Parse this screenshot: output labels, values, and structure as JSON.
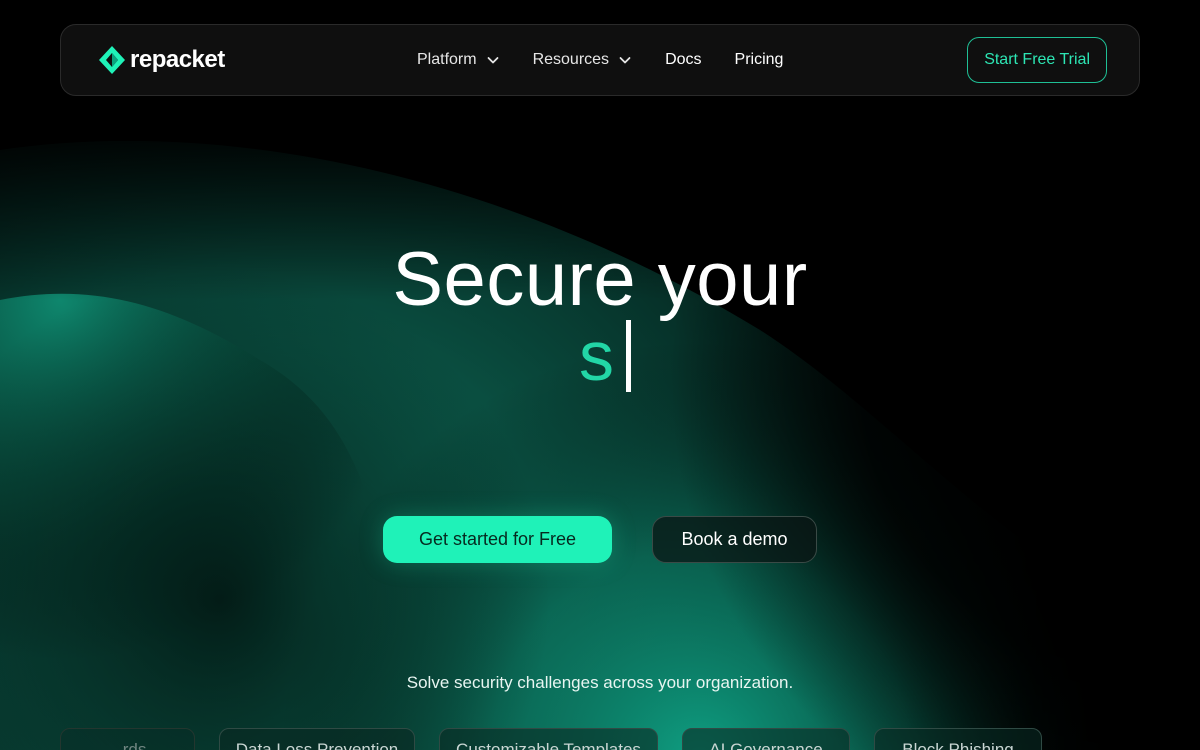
{
  "brand": {
    "name": "repacket",
    "accent": "#1ff2b8"
  },
  "nav": {
    "items": [
      {
        "label": "Platform",
        "has_dropdown": true
      },
      {
        "label": "Resources",
        "has_dropdown": true
      },
      {
        "label": "Docs",
        "has_dropdown": false
      },
      {
        "label": "Pricing",
        "has_dropdown": false
      }
    ],
    "cta_label": "Start Free Trial"
  },
  "hero": {
    "title": "Secure your",
    "typed_text": "s",
    "primary_cta": "Get started for Free",
    "secondary_cta": "Book a demo",
    "tagline": "Solve security challenges across your organization."
  },
  "solutions": [
    {
      "label": "...rds"
    },
    {
      "label": "Data Loss Prevention"
    },
    {
      "label": "Customizable Templates"
    },
    {
      "label": "AI Governance"
    },
    {
      "label": "Block Phishing"
    }
  ]
}
